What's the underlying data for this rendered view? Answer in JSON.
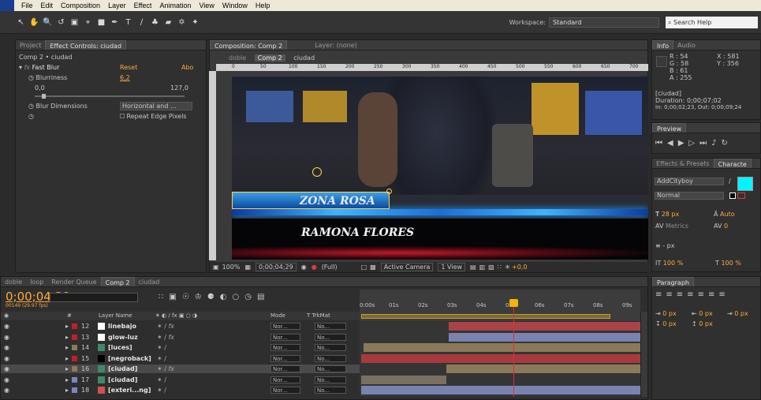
{
  "menu": [
    "File",
    "Edit",
    "Composition",
    "Layer",
    "Effect",
    "Animation",
    "View",
    "Window",
    "Help"
  ],
  "toolbar": {
    "workspace_label": "Workspace:",
    "workspace_value": "Standard",
    "search_placeholder": "Search Help"
  },
  "effect_controls": {
    "tabs": [
      "Project",
      "Effect Controls: ciudad"
    ],
    "breadcrumb": "Comp 2 • ciudad",
    "effect_name": "Fast Blur",
    "reset": "Reset",
    "about": "Abo",
    "blurriness_label": "Blurriness",
    "blurriness_value": "6,2",
    "slider_min": "0,0",
    "slider_max": "127,0",
    "slider_fraction": 0.05,
    "blur_dim_label": "Blur Dimensions",
    "blur_dim_value": "Horizontal and ...",
    "repeat_edge": "Repeat Edge Pixels"
  },
  "composition": {
    "tab": "Composition: Comp 2",
    "layer_tab": "Layer: (none)",
    "crumbs": [
      "doble",
      "Comp 2",
      "ciudad"
    ],
    "ruler": [
      "0",
      "50",
      "100",
      "150",
      "200",
      "250",
      "300",
      "350",
      "400",
      "450",
      "500",
      "550",
      "600",
      "650",
      "700"
    ],
    "title1": "ZONA ROSA",
    "title2": "RAMONA FLORES",
    "zoom": "100%",
    "timecode": "0;00;04;29",
    "resolution": "(Full)",
    "camera": "Active Camera",
    "view": "1 View",
    "exposure": "+0,0"
  },
  "info": {
    "tabs": [
      "Info",
      "Audio"
    ],
    "r": "R : 54",
    "g": "G : 58",
    "b": "B : 61",
    "a": "A : 255",
    "x": "X : 581",
    "y": "Y : 356",
    "layer": "[ciudad]",
    "duration": "Duration: 0;00;07;02",
    "inout": "In: 0;00;02;23, Out: 0;00;09;24"
  },
  "preview": {
    "tab": "Preview"
  },
  "character": {
    "tabs": [
      "Effects & Presets",
      "Characte"
    ],
    "font": "AddCityboy",
    "style": "Normal",
    "size": "28 px",
    "leading": "Auto",
    "kerning": "Metrics",
    "tracking": "0",
    "stroke": "- px",
    "vscale": "100 %",
    "hscale": "100 %",
    "fill_color": "#00f5ff"
  },
  "paragraph": {
    "tab": "Paragraph",
    "indent1": "0 px",
    "indent2": "0 px",
    "indent3": "0 px",
    "space1": "0 px",
    "space2": "0 px"
  },
  "timeline": {
    "tabs": [
      "doble",
      "loop",
      "Render Queue",
      "Comp 2",
      "ciudad"
    ],
    "timecode": "0;00;04;29",
    "fps": "00149 (29.97 fps)",
    "col_layer_name": "Layer Name",
    "col_mode": "Mode",
    "col_trkmat": "T  TrkMat",
    "time_labels": [
      "0:00s",
      "01s",
      "02s",
      "03s",
      "04s",
      "05s",
      "06s",
      "07s",
      "08s",
      "09s"
    ],
    "layers": [
      {
        "num": "12",
        "name": "linebajo",
        "color": "#c0202a",
        "thumb": "#ffffff",
        "mode": "Nor...",
        "trk": "No...",
        "fx": true
      },
      {
        "num": "13",
        "name": "glow-luz",
        "color": "#c0202a",
        "thumb": "#ffffff",
        "mode": "Nor...",
        "trk": "No...",
        "fx": true
      },
      {
        "num": "14",
        "name": "[luces]",
        "color": "#8c7a5a",
        "thumb": "#3d8a6a",
        "mode": "Nor...",
        "trk": "No...",
        "fx": false
      },
      {
        "num": "15",
        "name": "[negroback]",
        "color": "#c0202a",
        "thumb": "#000000",
        "mode": "Nor...",
        "trk": "No...",
        "fx": false
      },
      {
        "num": "16",
        "name": "[ciudad]",
        "color": "#8c7a5a",
        "thumb": "#3d8a6a",
        "mode": "Nor...",
        "trk": "No...",
        "fx": true
      },
      {
        "num": "17",
        "name": "[ciudad]",
        "color": "#7a86c0",
        "thumb": "#3d8a6a",
        "mode": "Nor...",
        "trk": "No...",
        "fx": false
      },
      {
        "num": "18",
        "name": "[exteri...ng]",
        "color": "#7a86c0",
        "thumb": "#d05050",
        "mode": "Nor...",
        "trk": "No...",
        "fx": false
      }
    ]
  }
}
